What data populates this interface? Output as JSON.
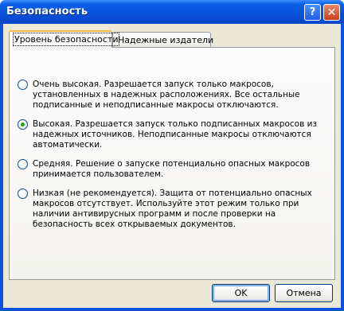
{
  "window": {
    "title": "Безопасность",
    "help_symbol": "?",
    "close_symbol": "✕"
  },
  "tabs": [
    {
      "label": "Уровень безопасности",
      "active": true
    },
    {
      "label": "Надежные издатели",
      "active": false
    }
  ],
  "options": [
    {
      "label": "Очень высокая. Разрешается запуск только макросов, установленных в надежных расположениях. Все остальные подписанные и неподписанные макросы отключаются.",
      "checked": false
    },
    {
      "label": "Высокая. Разрешается запуск только подписанных макросов из надежных источников. Неподписанные макросы отключаются автоматически.",
      "checked": true
    },
    {
      "label": "Средняя. Решение о запуске потенциально опасных макросов принимается пользователем.",
      "checked": false
    },
    {
      "label": "Низкая (не рекомендуется). Защита от потенциально опасных макросов отсутствует. Используйте этот режим только при наличии антивирусных программ и после проверки на безопасность всех открываемых документов.",
      "checked": false
    }
  ],
  "buttons": {
    "ok": "OK",
    "cancel": "Отмена"
  },
  "colors": {
    "titlebar": "#0750d8",
    "dialog_face": "#ece9d8",
    "radio_checked": "#21a121",
    "active_tab_highlight": "#f7b545"
  }
}
